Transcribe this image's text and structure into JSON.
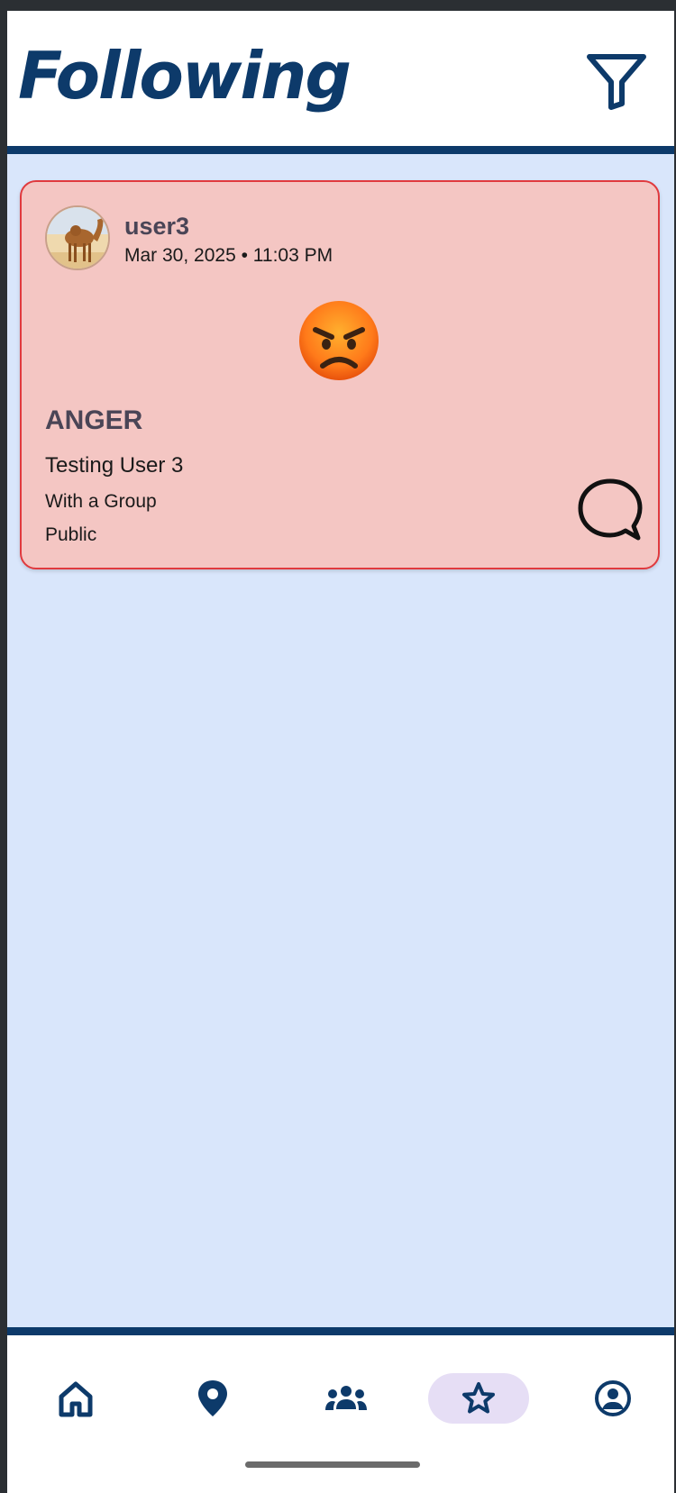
{
  "header": {
    "title": "Following",
    "filter_icon": "filter-icon"
  },
  "colors": {
    "brand": "#0d3a6a",
    "feed_background": "#d9e6fb",
    "card_background": "#f4c6c3",
    "card_border": "#e03a3e",
    "nav_active": "#e6def5"
  },
  "posts": [
    {
      "username": "user3",
      "timestamp": "Mar 30, 2025 • 11:03 PM",
      "avatar": "camel-avatar",
      "emotion_icon": "angry-face-emoji",
      "emotion": "ANGER",
      "text": "Testing User 3",
      "group": "With a Group",
      "visibility": "Public",
      "comment_icon": "comment-bubble-icon"
    }
  ],
  "nav": {
    "items": [
      {
        "icon": "home-icon",
        "active": false
      },
      {
        "icon": "map-pin-icon",
        "active": false
      },
      {
        "icon": "groups-icon",
        "active": false
      },
      {
        "icon": "star-icon",
        "active": true
      },
      {
        "icon": "account-icon",
        "active": false
      }
    ]
  }
}
